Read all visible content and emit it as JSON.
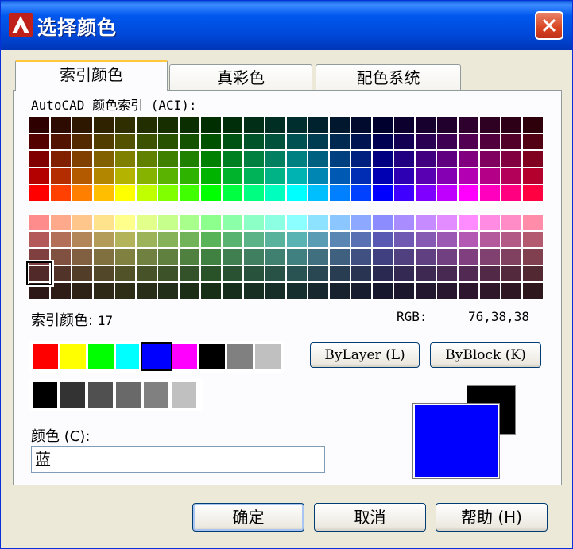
{
  "title": "选择颜色",
  "tabs": [
    {
      "label": "索引颜色"
    },
    {
      "label": "真彩色"
    },
    {
      "label": "配色系统"
    }
  ],
  "aci_label": "AutoCAD 颜色索引 (ACI):",
  "index": {
    "label": "索引颜色:",
    "value": "17"
  },
  "rgb": {
    "label": "RGB:",
    "value": "76,38,38"
  },
  "standard_colors": [
    "#ff0000",
    "#ffff00",
    "#00ff00",
    "#00ffff",
    "#0000ff",
    "#ff00ff",
    "#000000",
    "#808080",
    "#c0c0c0"
  ],
  "selected_standard": 4,
  "gray_colors": [
    "#000000",
    "#333333",
    "#505050",
    "#696969",
    "#808080",
    "#c0c0c0",
    "#a8a8a8"
  ],
  "buttons": {
    "bylayer": "ByLayer (L)",
    "byblock": "ByBlock (K)",
    "ok": "确定",
    "cancel": "取消",
    "help": "帮助 (H)"
  },
  "color_field": {
    "label": "颜色 (C):",
    "value": "蓝"
  },
  "preview": {
    "new_color": "#0000ff",
    "old_color": "#000000"
  },
  "icons": {
    "app": "autocad-icon",
    "close": "close-icon"
  }
}
